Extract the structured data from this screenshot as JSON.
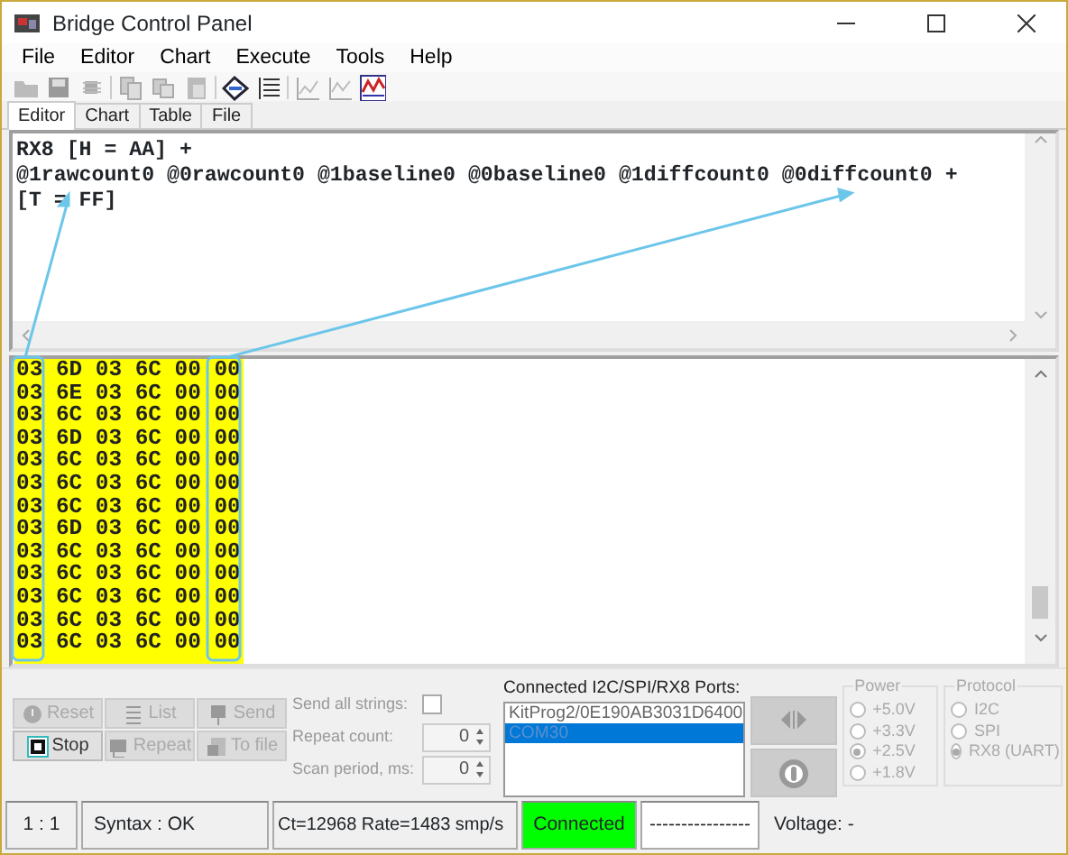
{
  "window": {
    "title": "Bridge Control Panel"
  },
  "menu": [
    "File",
    "Editor",
    "Chart",
    "Execute",
    "Tools",
    "Help"
  ],
  "tabs": [
    {
      "label": "Editor",
      "selected": true
    },
    {
      "label": "Chart",
      "selected": false
    },
    {
      "label": "Table",
      "selected": false
    },
    {
      "label": "File",
      "selected": false
    }
  ],
  "editor": {
    "lines": [
      "RX8 [H = AA] +",
      "@1rawcount0 @0rawcount0 @1baseline0 @0baseline0 @1diffcount0 @0diffcount0 +",
      "[T = FF]"
    ]
  },
  "output": {
    "rows": [
      "03 6D 03 6C 00 00",
      "03 6E 03 6C 00 00",
      "03 6C 03 6C 00 00",
      "03 6D 03 6C 00 00",
      "03 6C 03 6C 00 00",
      "03 6C 03 6C 00 00",
      "03 6C 03 6C 00 00",
      "03 6D 03 6C 00 00",
      "03 6C 03 6C 00 00",
      "03 6C 03 6C 00 00",
      "03 6C 03 6C 00 00",
      "03 6C 03 6C 00 00",
      "03 6C 03 6C 00 00"
    ]
  },
  "buttons": [
    {
      "label": "Reset",
      "kind": "reset",
      "disabled": true
    },
    {
      "label": "List",
      "kind": "list",
      "disabled": true
    },
    {
      "label": "Send",
      "kind": "send",
      "disabled": true
    },
    {
      "label": "Stop",
      "kind": "stop",
      "disabled": false
    },
    {
      "label": "Repeat",
      "kind": "repeat",
      "disabled": true
    },
    {
      "label": "To file",
      "kind": "file",
      "disabled": true
    }
  ],
  "options": {
    "send_all": {
      "label": "Send all strings:",
      "checked": false
    },
    "repeat": {
      "label": "Repeat count:",
      "value": "0"
    },
    "scan": {
      "label": "Scan period, ms:",
      "value": "0"
    }
  },
  "ports": {
    "label": "Connected I2C/SPI/RX8 Ports:",
    "items": [
      {
        "label": "KitProg2/0E190AB3031D6400",
        "selected": false
      },
      {
        "label": "COM30",
        "selected": true
      }
    ]
  },
  "power": {
    "title": "Power",
    "options": [
      {
        "label": "+5.0V",
        "selected": false
      },
      {
        "label": "+3.3V",
        "selected": false
      },
      {
        "label": "+2.5V",
        "selected": true
      },
      {
        "label": "+1.8V",
        "selected": false
      }
    ]
  },
  "protocol": {
    "title": "Protocol",
    "options": [
      {
        "label": "I2C",
        "selected": false
      },
      {
        "label": "SPI",
        "selected": false
      },
      {
        "label": "RX8 (UART)",
        "selected": true
      }
    ]
  },
  "status_bar": {
    "position": "1 : 1",
    "syntax": "Syntax : OK",
    "rate": "Ct=12968 Rate=1483 smp/s",
    "connection": "Connected",
    "connected": true,
    "dashes": "----------------",
    "voltage": "Voltage: -"
  }
}
